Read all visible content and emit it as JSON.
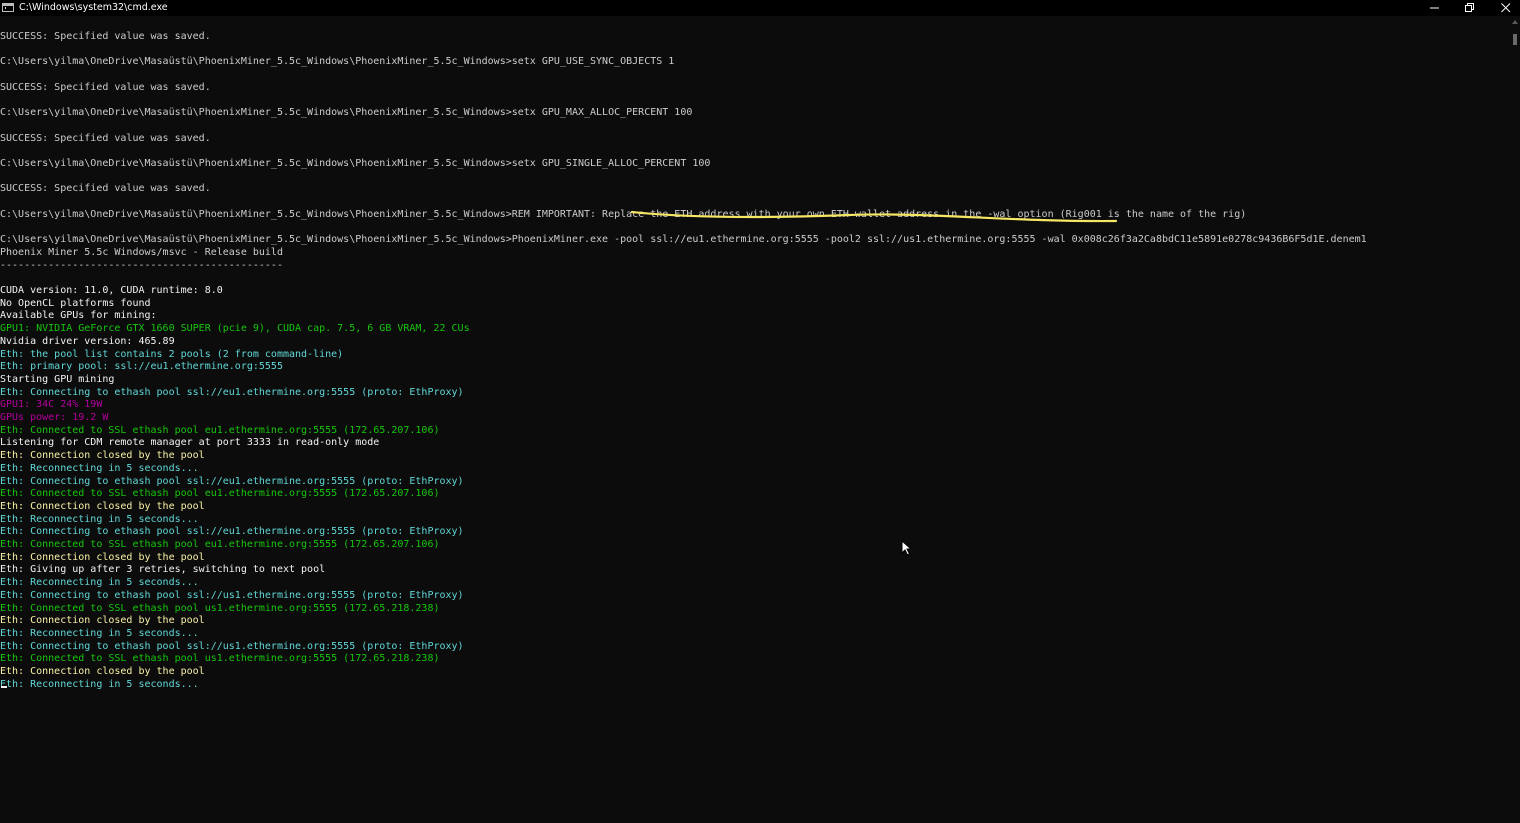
{
  "window": {
    "title": "C:\\Windows\\system32\\cmd.exe"
  },
  "console": {
    "lines": [
      "SUCCESS: Specified value was saved.",
      "",
      "C:\\Users\\yilma\\OneDrive\\Masaüstü\\PhoenixMiner_5.5c_Windows\\PhoenixMiner_5.5c_Windows>setx GPU_USE_SYNC_OBJECTS 1",
      "",
      "SUCCESS: Specified value was saved.",
      "",
      "C:\\Users\\yilma\\OneDrive\\Masaüstü\\PhoenixMiner_5.5c_Windows\\PhoenixMiner_5.5c_Windows>setx GPU_MAX_ALLOC_PERCENT 100",
      "",
      "SUCCESS: Specified value was saved.",
      "",
      "C:\\Users\\yilma\\OneDrive\\Masaüstü\\PhoenixMiner_5.5c_Windows\\PhoenixMiner_5.5c_Windows>setx GPU_SINGLE_ALLOC_PERCENT 100",
      "",
      "SUCCESS: Specified value was saved.",
      "",
      "C:\\Users\\yilma\\OneDrive\\Masaüstü\\PhoenixMiner_5.5c_Windows\\PhoenixMiner_5.5c_Windows>REM IMPORTANT: Replace the ETH address with your own ETH wallet address in the -wal option (Rig001 is the name of the rig)",
      "",
      "C:\\Users\\yilma\\OneDrive\\Masaüstü\\PhoenixMiner_5.5c_Windows\\PhoenixMiner_5.5c_Windows>PhoenixMiner.exe -pool ssl://eu1.ethermine.org:5555 -pool2 ssl://us1.ethermine.org:5555 -wal 0x008c26f3a2Ca8bdC11e5891e0278c9436B6F5d1E.denem1",
      "Phoenix Miner 5.5c Windows/msvc - Release build",
      "-----------------------------------------------",
      "",
      "CUDA version: 11.0, CUDA runtime: 8.0",
      "No OpenCL platforms found",
      "Available GPUs for mining:",
      "GPU1: NVIDIA GeForce GTX 1660 SUPER (pcie 9), CUDA cap. 7.5, 6 GB VRAM, 22 CUs",
      "Nvidia driver version: 465.89",
      "Eth: the pool list contains 2 pools (2 from command-line)",
      "Eth: primary pool: ssl://eu1.ethermine.org:5555",
      "Starting GPU mining",
      "Eth: Connecting to ethash pool ssl://eu1.ethermine.org:5555 (proto: EthProxy)",
      "GPU1: 34C 24% 19W",
      "GPUs power: 19.2 W",
      "Eth: Connected to SSL ethash pool eu1.ethermine.org:5555 (172.65.207.106)",
      "Listening for CDM remote manager at port 3333 in read-only mode",
      "Eth: Connection closed by the pool",
      "Eth: Reconnecting in 5 seconds...",
      "Eth: Connecting to ethash pool ssl://eu1.ethermine.org:5555 (proto: EthProxy)",
      "Eth: Connected to SSL ethash pool eu1.ethermine.org:5555 (172.65.207.106)",
      "Eth: Connection closed by the pool",
      "Eth: Reconnecting in 5 seconds...",
      "Eth: Connecting to ethash pool ssl://eu1.ethermine.org:5555 (proto: EthProxy)",
      "Eth: Connected to SSL ethash pool eu1.ethermine.org:5555 (172.65.207.106)",
      "Eth: Connection closed by the pool",
      "Eth: Giving up after 3 retries, switching to next pool",
      "Eth: Reconnecting in 5 seconds...",
      "Eth: Connecting to ethash pool ssl://us1.ethermine.org:5555 (proto: EthProxy)",
      "Eth: Connected to SSL ethash pool us1.ethermine.org:5555 (172.65.218.238)",
      "Eth: Connection closed by the pool",
      "Eth: Reconnecting in 5 seconds...",
      "Eth: Connecting to ethash pool ssl://us1.ethermine.org:5555 (proto: EthProxy)",
      "Eth: Connected to SSL ethash pool us1.ethermine.org:5555 (172.65.218.238)",
      "Eth: Connection closed by the pool",
      "Eth: Reconnecting in 5 seconds..."
    ]
  },
  "colors": {
    "background": "#0c0c0c",
    "default_text": "#cccccc",
    "bright_white": "#f2f2f2",
    "cyan": "#61d6d6",
    "green": "#16c60c",
    "yellow": "#f9f1a5",
    "magenta": "#b4009e",
    "annotation_underline": "#f5e663"
  },
  "icons": {
    "app": "cmd-console-icon",
    "minimize": "minimize-icon",
    "maximize": "restore-icon",
    "close": "close-icon",
    "pointer": "mouse-pointer-icon"
  }
}
